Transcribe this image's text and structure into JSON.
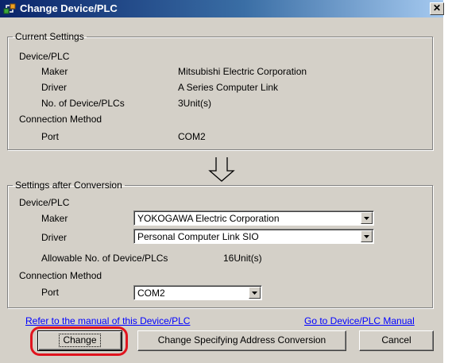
{
  "window": {
    "title": "Change Device/PLC",
    "close_glyph": "✕"
  },
  "current": {
    "group_label": "Current Settings",
    "device_heading": "Device/PLC",
    "maker_label": "Maker",
    "maker_value": "Mitsubishi Electric Corporation",
    "driver_label": "Driver",
    "driver_value": "A Series Computer Link",
    "count_label": "No. of Device/PLCs",
    "count_value": "3Unit(s)",
    "connection_heading": "Connection Method",
    "port_label": "Port",
    "port_value": "COM2"
  },
  "conversion_arrow_icon": "down-arrow-icon",
  "after": {
    "group_label": "Settings after Conversion",
    "device_heading": "Device/PLC",
    "maker_label": "Maker",
    "maker_value": "YOKOGAWA Electric Corporation",
    "driver_label": "Driver",
    "driver_value": "Personal Computer Link SIO",
    "allowable_label": "Allowable No. of Device/PLCs",
    "allowable_value": "16Unit(s)",
    "connection_heading": "Connection Method",
    "port_label": "Port",
    "port_value": "COM2"
  },
  "links": {
    "refer_manual": "Refer to the manual of this Device/PLC",
    "goto_manual": "Go to Device/PLC Manual"
  },
  "buttons": {
    "change": "Change",
    "change_address": "Change Specifying Address Conversion",
    "cancel": "Cancel"
  },
  "colors": {
    "link": "#0000ff",
    "highlight": "#e0141e",
    "title_bar": "#0a246a",
    "dialog_face": "#d4d0c8"
  }
}
